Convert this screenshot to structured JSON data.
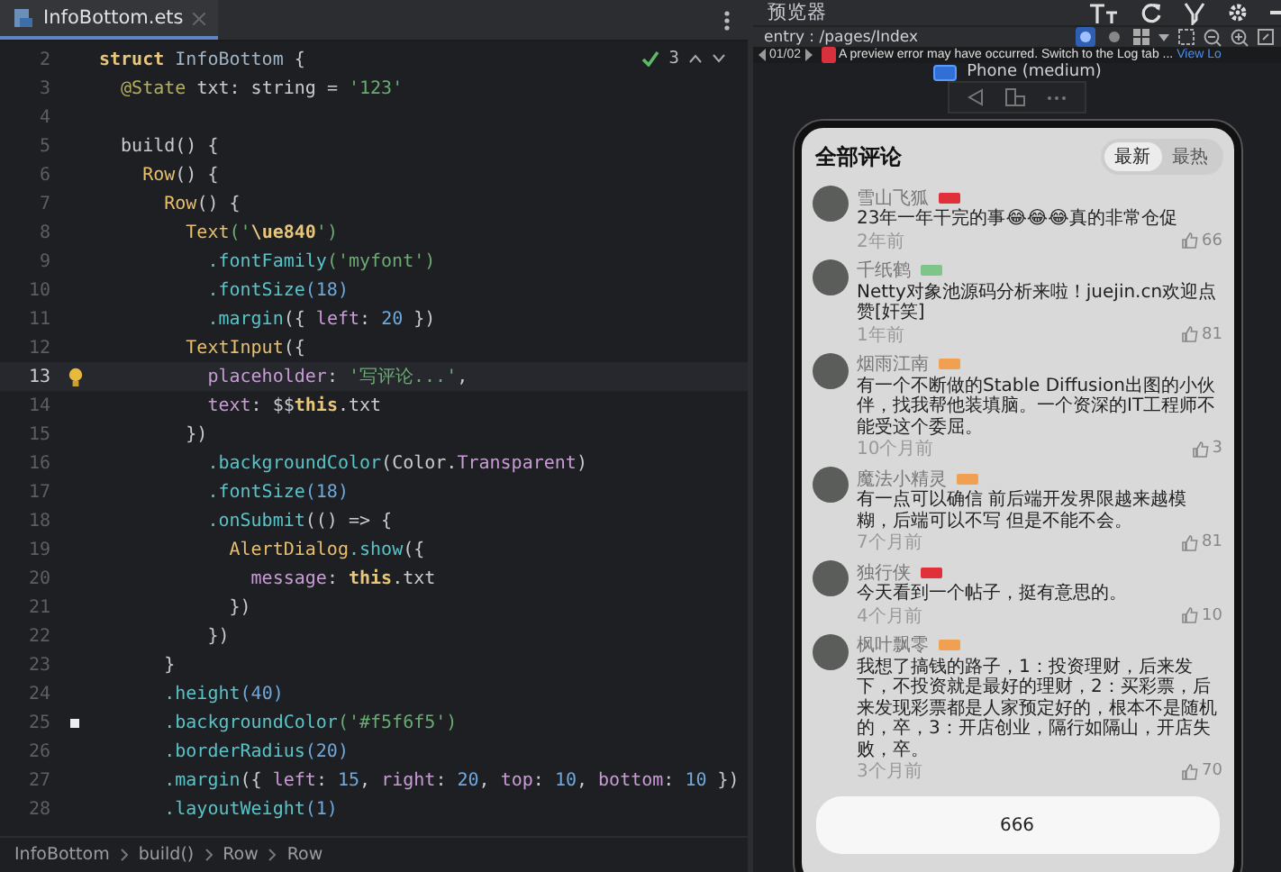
{
  "editor": {
    "tab": {
      "label": "InfoBottom.ets",
      "selected": true
    },
    "inspection": {
      "count": "3"
    },
    "lines": [
      {
        "n": "2",
        "selected": false,
        "hint": false,
        "marked": false,
        "tokens": [
          {
            "kind": "kw",
            "text": "struct"
          },
          {
            "kind": "name",
            "text": " InfoBottom"
          },
          {
            "kind": "plain",
            "text": " {"
          }
        ]
      },
      {
        "n": "3",
        "selected": false,
        "hint": false,
        "marked": false,
        "tokens": [
          {
            "kind": "dec",
            "text": "  @State"
          },
          {
            "kind": "plain",
            "text": " txt: string = "
          },
          {
            "kind": "str",
            "text": "'123'"
          }
        ]
      },
      {
        "n": "4",
        "selected": false,
        "hint": false,
        "marked": false
      },
      {
        "n": "5",
        "selected": false,
        "hint": false,
        "marked": false,
        "tokens": [
          {
            "kind": "plain",
            "text": "  build() {"
          }
        ]
      },
      {
        "n": "6",
        "selected": false,
        "hint": false,
        "marked": false,
        "tokens": [
          {
            "kind": "type",
            "text": "    Row"
          },
          {
            "kind": "plain",
            "text": "() {"
          }
        ]
      },
      {
        "n": "7",
        "selected": false,
        "hint": false,
        "marked": false,
        "tokens": [
          {
            "kind": "type",
            "text": "      Row"
          },
          {
            "kind": "plain",
            "text": "() {"
          }
        ]
      },
      {
        "n": "8",
        "selected": false,
        "hint": false,
        "marked": false,
        "tokens": [
          {
            "kind": "type",
            "text": "        Text"
          },
          {
            "kind": "str",
            "text": "('"
          },
          {
            "kind": "kw",
            "text": "\\ue840"
          },
          {
            "kind": "str",
            "text": "')"
          }
        ]
      },
      {
        "n": "9",
        "selected": false,
        "hint": false,
        "marked": false,
        "tokens": [
          {
            "kind": "fn",
            "text": "          .fontFamily"
          },
          {
            "kind": "str",
            "text": "('myfont')"
          }
        ]
      },
      {
        "n": "10",
        "selected": false,
        "hint": false,
        "marked": false,
        "tokens": [
          {
            "kind": "fn",
            "text": "          .fontSize"
          },
          {
            "kind": "num",
            "text": "(18)"
          }
        ]
      },
      {
        "n": "11",
        "selected": false,
        "hint": false,
        "marked": false,
        "tokens": [
          {
            "kind": "fn",
            "text": "          .margin"
          },
          {
            "kind": "plain",
            "text": "({ "
          },
          {
            "kind": "prop",
            "text": "left"
          },
          {
            "kind": "plain",
            "text": ": "
          },
          {
            "kind": "num",
            "text": "20"
          },
          {
            "kind": "plain",
            "text": " })"
          }
        ]
      },
      {
        "n": "12",
        "selected": false,
        "hint": false,
        "marked": false,
        "tokens": [
          {
            "kind": "type",
            "text": "        TextInput"
          },
          {
            "kind": "plain",
            "text": "({"
          }
        ]
      },
      {
        "n": "13",
        "selected": true,
        "hint": true,
        "marked": false,
        "tokens": [
          {
            "kind": "prop",
            "text": "          placeholder"
          },
          {
            "kind": "plain",
            "text": ": "
          },
          {
            "kind": "str",
            "text": "'写评论...'"
          },
          {
            "kind": "plain",
            "text": ","
          }
        ]
      },
      {
        "n": "14",
        "selected": false,
        "hint": false,
        "marked": false,
        "tokens": [
          {
            "kind": "prop",
            "text": "          text"
          },
          {
            "kind": "plain",
            "text": ": $$"
          },
          {
            "kind": "kw",
            "text": "this"
          },
          {
            "kind": "plain",
            "text": ".txt"
          }
        ]
      },
      {
        "n": "15",
        "selected": false,
        "hint": false,
        "marked": false,
        "tokens": [
          {
            "kind": "plain",
            "text": "        })"
          }
        ]
      },
      {
        "n": "16",
        "selected": false,
        "hint": false,
        "marked": false,
        "tokens": [
          {
            "kind": "fn",
            "text": "          .backgroundColor"
          },
          {
            "kind": "plain",
            "text": "(Color."
          },
          {
            "kind": "prop",
            "text": "Transparent"
          },
          {
            "kind": "plain",
            "text": ")"
          }
        ]
      },
      {
        "n": "17",
        "selected": false,
        "hint": false,
        "marked": false,
        "tokens": [
          {
            "kind": "fn",
            "text": "          .fontSize"
          },
          {
            "kind": "num",
            "text": "(18)"
          }
        ]
      },
      {
        "n": "18",
        "selected": false,
        "hint": false,
        "marked": false,
        "tokens": [
          {
            "kind": "fn",
            "text": "          .onSubmit"
          },
          {
            "kind": "plain",
            "text": "(() => {"
          }
        ]
      },
      {
        "n": "19",
        "selected": false,
        "hint": false,
        "marked": false,
        "tokens": [
          {
            "kind": "type",
            "text": "            AlertDialog"
          },
          {
            "kind": "fn",
            "text": ".show"
          },
          {
            "kind": "plain",
            "text": "({"
          }
        ]
      },
      {
        "n": "20",
        "selected": false,
        "hint": false,
        "marked": false,
        "tokens": [
          {
            "kind": "prop",
            "text": "              message"
          },
          {
            "kind": "plain",
            "text": ": "
          },
          {
            "kind": "kw",
            "text": "this"
          },
          {
            "kind": "plain",
            "text": ".txt"
          }
        ]
      },
      {
        "n": "21",
        "selected": false,
        "hint": false,
        "marked": false,
        "tokens": [
          {
            "kind": "plain",
            "text": "            })"
          }
        ]
      },
      {
        "n": "22",
        "selected": false,
        "hint": false,
        "marked": false,
        "tokens": [
          {
            "kind": "plain",
            "text": "          })"
          }
        ]
      },
      {
        "n": "23",
        "selected": false,
        "hint": false,
        "marked": false,
        "tokens": [
          {
            "kind": "plain",
            "text": "      }"
          }
        ]
      },
      {
        "n": "24",
        "selected": false,
        "hint": false,
        "marked": false,
        "tokens": [
          {
            "kind": "fn",
            "text": "      .height"
          },
          {
            "kind": "num",
            "text": "(40)"
          }
        ]
      },
      {
        "n": "25",
        "selected": false,
        "hint": false,
        "marked": true,
        "tokens": [
          {
            "kind": "fn",
            "text": "      .backgroundColor"
          },
          {
            "kind": "str",
            "text": "('#f5f6f5')"
          }
        ]
      },
      {
        "n": "26",
        "selected": false,
        "hint": false,
        "marked": false,
        "tokens": [
          {
            "kind": "fn",
            "text": "      .borderRadius"
          },
          {
            "kind": "num",
            "text": "(20)"
          }
        ]
      },
      {
        "n": "27",
        "selected": false,
        "hint": false,
        "marked": false,
        "tokens": [
          {
            "kind": "fn",
            "text": "      .margin"
          },
          {
            "kind": "plain",
            "text": "({ "
          },
          {
            "kind": "prop",
            "text": "left"
          },
          {
            "kind": "plain",
            "text": ": "
          },
          {
            "kind": "num",
            "text": "15"
          },
          {
            "kind": "plain",
            "text": ", "
          },
          {
            "kind": "prop",
            "text": "right"
          },
          {
            "kind": "plain",
            "text": ": "
          },
          {
            "kind": "num",
            "text": "20"
          },
          {
            "kind": "plain",
            "text": ", "
          },
          {
            "kind": "prop",
            "text": "top"
          },
          {
            "kind": "plain",
            "text": ": "
          },
          {
            "kind": "num",
            "text": "10"
          },
          {
            "kind": "plain",
            "text": ", "
          },
          {
            "kind": "prop",
            "text": "bottom"
          },
          {
            "kind": "plain",
            "text": ": "
          },
          {
            "kind": "num",
            "text": "10"
          },
          {
            "kind": "plain",
            "text": " })"
          }
        ]
      },
      {
        "n": "28",
        "selected": false,
        "hint": false,
        "marked": false,
        "tokens": [
          {
            "kind": "fn",
            "text": "      .layoutWeight"
          },
          {
            "kind": "num",
            "text": "(1)"
          }
        ]
      }
    ],
    "breadcrumbs": [
      "InfoBottom",
      "build()",
      "Row",
      "Row"
    ]
  },
  "preview": {
    "title": "预览器",
    "entry": "entry : /pages/Index",
    "view_toggles": [
      {
        "selected": true
      },
      {
        "selected": false
      }
    ],
    "error_bar": {
      "counter": "01/02",
      "message": "A preview error may have occurred. Switch to the Log tab ...",
      "link": "View Lo"
    },
    "device": "Phone (medium)",
    "phone": {
      "title": "全部评论",
      "sort_tabs": [
        {
          "label": "最新",
          "selected": true
        },
        {
          "label": "最热",
          "selected": false
        }
      ],
      "comments": [
        {
          "name": "雪山飞狐",
          "color": "#e0303a",
          "text": "23年一年干完的事😂😂😂真的非常仓促",
          "time": "2年前",
          "likes": "66"
        },
        {
          "name": "千纸鹤",
          "color": "#7fc58a",
          "text": "Netty对象池源码分析来啦！juejin.cn欢迎点赞[奸笑]",
          "time": "1年前",
          "likes": "81"
        },
        {
          "name": "烟雨江南",
          "color": "#f0a050",
          "text": "有一个不断做的Stable Diffusion出图的小伙伴，找我帮他装填脑。一个资深的IT工程师不能受这个委屈。",
          "time": "10个月前",
          "likes": "3"
        },
        {
          "name": "魔法小精灵",
          "color": "#f0a050",
          "text": "有一点可以确信 前后端开发界限越来越模糊，后端可以不写 但是不能不会。",
          "time": "7个月前",
          "likes": "81"
        },
        {
          "name": "独行侠",
          "color": "#e0303a",
          "text": "今天看到一个帖子，挺有意思的。",
          "time": "4个月前",
          "likes": "10"
        },
        {
          "name": "枫叶飘零",
          "color": "#f0a050",
          "text": "我想了搞钱的路子，1：投资理财，后来发下，不投资就是最好的理财，2：买彩票，后来发现彩票都是人家预定好的，根本不是随机的，卒，3：开店创业，隔行如隔山，开店失败，卒。",
          "time": "3个月前",
          "likes": "70"
        }
      ],
      "input": {
        "value": "666"
      }
    }
  }
}
